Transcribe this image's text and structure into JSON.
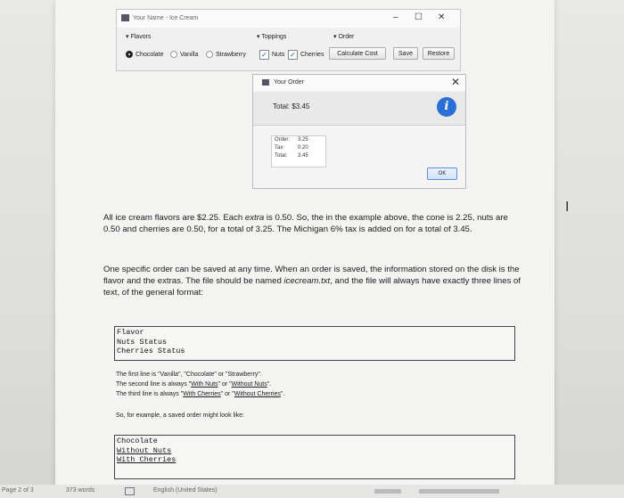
{
  "app": {
    "title": "Your Name - Ice Cream",
    "flavors_heading": "Flavors",
    "toppings_heading": "Toppings",
    "order_heading": "Order",
    "flavors": [
      {
        "label": "Chocolate",
        "selected": true
      },
      {
        "label": "Vanilla",
        "selected": false
      },
      {
        "label": "Strawberry",
        "selected": false
      }
    ],
    "toppings": [
      {
        "label": "Nuts",
        "checked": true
      },
      {
        "label": "Cherries",
        "checked": true
      }
    ],
    "buttons": {
      "calculate": "Calculate Cost",
      "save": "Save",
      "restore": "Restore"
    }
  },
  "dialog": {
    "title": "Your Order",
    "total_line": "Total: $3.45",
    "rows": [
      {
        "k": "Order:",
        "v": "3.25"
      },
      {
        "k": "Tax:",
        "v": "0.20"
      },
      {
        "k": "Total:",
        "v": "3.45"
      }
    ],
    "ok_label": "OK"
  },
  "doc": {
    "para1_a": "All ice cream flavors are $2.25. Each ",
    "para1_em": "extra",
    "para1_b": " is 0.50. So, the in the example above, the cone is 2.25, nuts are 0.50 and cherries are 0.50, for a total of 3.25. The Michigan 6% tax is added on for a total of 3.45.",
    "para2_a": "One specific order can be saved at any time. When an order is saved, the information stored on the disk is the flavor and the extras. The file should be named ",
    "para2_em": "icecream.txt",
    "para2_b": ", and the file will always have exactly three lines of text, of the general format:",
    "format_lines": [
      "Flavor",
      "Nuts Status",
      "Cherries Status"
    ],
    "line1_text": "The first line is \"Vanilla\", \"Chocolate\" or \"Strawberry\".",
    "line2_pre": "The second line is always \"",
    "line2_u1": "With Nuts",
    "line2_mid": "\" or \"",
    "line2_u2": "Without Nuts",
    "line2_post": "\".",
    "line3_pre": "The third line is always \"",
    "line3_u1": "With Cherries",
    "line3_mid": "\" or \"",
    "line3_u2": "Without Cherries",
    "line3_post": "\".",
    "example_intro": "So, for example, a saved order might look like:",
    "example_lines": [
      "Chocolate",
      "Without Nuts",
      "With Cherries"
    ]
  },
  "status": {
    "page": "Page 2 of 3",
    "words": "373 words",
    "language": "English (United States)"
  }
}
